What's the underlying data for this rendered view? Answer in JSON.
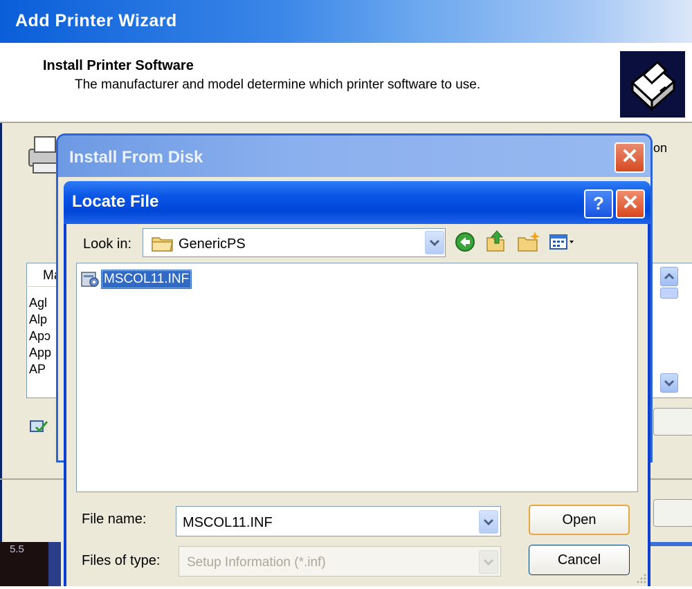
{
  "wizard": {
    "title": "Add Printer Wizard",
    "header_title": "Install Printer Software",
    "header_desc": "The manufacturer and model determine which printer software to use.",
    "partial_text_right": "on",
    "list_header": "Ma",
    "list_rows": [
      "Agl",
      "Alp",
      "Apɔ",
      "App",
      "AP"
    ]
  },
  "install_from_disk": {
    "title": "Install From Disk",
    "close_label": "✕"
  },
  "locate_file": {
    "title": "Locate File",
    "help_label": "?",
    "close_label": "✕",
    "look_in_label": "Look in:",
    "look_in_value": "GenericPS",
    "files": [
      {
        "name": "MSCOL11.INF",
        "selected": true
      }
    ],
    "file_name_label": "File name:",
    "file_name_value": "MSCOL11.INF",
    "files_of_type_label": "Files of type:",
    "files_of_type_value": "Setup Information (*.inf)",
    "open_label": "Open",
    "cancel_label": "Cancel",
    "dropdown_glyph": "⌄"
  },
  "taskbar": {
    "corner_text": "5.5"
  },
  "icons": {
    "accent_folder": "#e8b540",
    "title_blue": "#0046d8",
    "selection_blue": "#316ac5"
  }
}
